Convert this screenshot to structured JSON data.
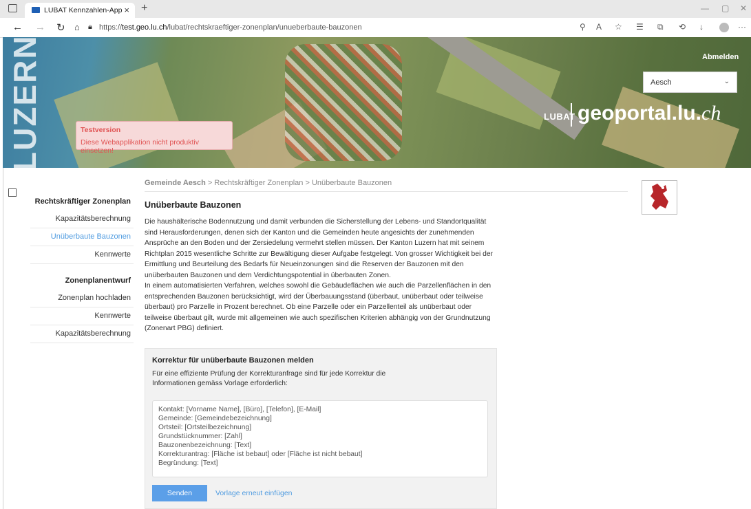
{
  "browser": {
    "tab_title": "LUBAT Kennzahlen-App",
    "tab_close": "×",
    "new_tab": "+",
    "url_prefix": "https://",
    "url_host": "test.geo.lu.ch",
    "url_path": "/lubat/rechtskraeftiger-zonenplan/unueberbaute-bauzonen",
    "win_min": "—",
    "win_max": "▢",
    "win_close": "✕"
  },
  "banner": {
    "vertical_brand": "LUZERN",
    "logout_label": "Abmelden",
    "municipality_select": "Aesch",
    "lubat_label": "LUBAT",
    "geoportal_main": "geoportal.lu.",
    "geoportal_suffix": "ch",
    "test_title": "Testversion",
    "test_message": "Diese Webapplikation nicht produktiv einsetzen!"
  },
  "sidebar": {
    "section1_title": "Rechtskräftiger Zonenplan",
    "section1_items": [
      "Kapazitätsberechnung",
      "Unüberbaute Bauzonen",
      "Kennwerte"
    ],
    "section2_title": "Zonenplanentwurf",
    "section2_items": [
      "Zonenplan hochladen",
      "Kennwerte",
      "Kapazitätsberechnung"
    ]
  },
  "main": {
    "breadcrumb_root": "Gemeinde Aesch",
    "breadcrumb_rest": " > Rechtskräftiger Zonenplan > Unüberbaute Bauzonen",
    "title": "Unüberbaute Bauzonen",
    "paragraph1": "Die haushälterische Bodennutzung und damit verbunden die Sicherstellung der Lebens- und Standortqualität sind Herausforderungen, denen sich der Kanton und die Gemeinden heute angesichts der zunehmenden Ansprüche an den Boden und der Zersiedelung vermehrt stellen müssen. Der Kanton Luzern hat mit seinem Richtplan 2015 wesentliche Schritte zur Bewältigung dieser Aufgabe festgelegt. Von grosser Wichtigkeit bei der Ermittlung und Beurteilung des Bedarfs für Neueinzonungen sind die Reserven der Bauzonen mit den unüberbauten Bauzonen und dem Verdichtungspotential in überbauten Zonen.",
    "paragraph2": "In einem automatisierten Verfahren, welches sowohl die Gebäudeflächen wie auch die Parzellenflächen in den entsprechenden Bauzonen berücksichtigt, wird der Überbauungsstand (überbaut, unüberbaut oder teilweise überbaut) pro Parzelle in Prozent berechnet. Ob eine Parzelle oder ein Parzellenteil als unüberbaut oder teilweise überbaut gilt, wurde mit allgemeinen wie auch spezifischen Kriterien abhängig von der Grundnutzung (Zonenart PBG) definiert."
  },
  "panel": {
    "title": "Korrektur für unüberbaute Bauzonen melden",
    "description": "Für eine effiziente Prüfung der Korrekturanfrage sind für jede Korrektur die Informationen gemäss Vorlage erforderlich:",
    "template_lines": [
      "Kontakt: [Vorname Name], [Büro], [Telefon], [E-Mail]",
      "Gemeinde: [Gemeindebezeichnung]",
      "Ortsteil: [Ortsteilbezeichnung]",
      "Grundstücknummer: [Zahl]",
      "Bauzonenbezeichnung: [Text]",
      "Korrekturantrag: [Fläche ist bebaut] oder [Fläche ist nicht bebaut]",
      "Begründung: [Text]"
    ],
    "send_label": "Senden",
    "reinsert_label": "Vorlage erneut einfügen"
  }
}
